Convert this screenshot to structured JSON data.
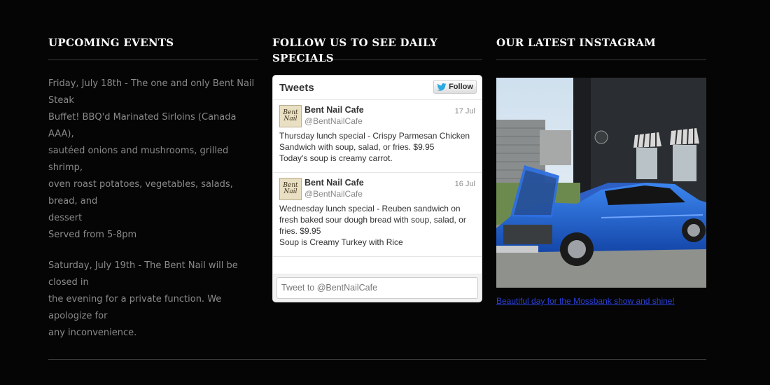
{
  "events": {
    "title": "UPCOMING EVENTS",
    "items": [
      {
        "lines": [
          "Friday, July 18th - The one and only Bent Nail Steak",
          "Buffet! BBQ'd Marinated Sirloins (Canada AAA),",
          "sautéed onions and mushrooms, grilled shrimp,",
          "oven roast potatoes, vegetables, salads, bread, and",
          "dessert",
          "Served from 5-8pm"
        ]
      },
      {
        "lines": [
          "Saturday, July 19th - The Bent Nail will be closed in",
          "the evening for a private function. We apologize for",
          "any inconvenience."
        ]
      }
    ]
  },
  "twitter": {
    "title": "FOLLOW US TO SEE DAILY SPECIALS",
    "widget_title": "Tweets",
    "follow_label": "Follow",
    "avatar_text": "Bent Nail",
    "tweets": [
      {
        "name": "Bent Nail Cafe",
        "handle": "@BentNailCafe",
        "date": "17 Jul",
        "lines": [
          "Thursday lunch special - Crispy Parmesan Chicken",
          "Sandwich with soup, salad, or fries.  $9.95",
          "Today's soup is creamy carrot."
        ]
      },
      {
        "name": "Bent Nail Cafe",
        "handle": "@BentNailCafe",
        "date": "16 Jul",
        "lines": [
          "Wednesday lunch special - Reuben sandwich on",
          "fresh baked sour dough bread with soup, salad, or",
          "fries.  $9.95",
          "Soup is Creamy Turkey with Rice"
        ]
      }
    ],
    "input_placeholder": "Tweet to @BentNailCafe"
  },
  "instagram": {
    "title": "OUR LATEST INSTAGRAM",
    "caption": "Beautiful day for the Mossbank show and shine!"
  },
  "colors": {
    "background": "#050505",
    "heading": "#ffffff",
    "body_text": "#8a8a8a",
    "link": "#2a3fd6",
    "car_blue": "#1e5fd0",
    "twitter_blue": "#2ba9e1"
  }
}
